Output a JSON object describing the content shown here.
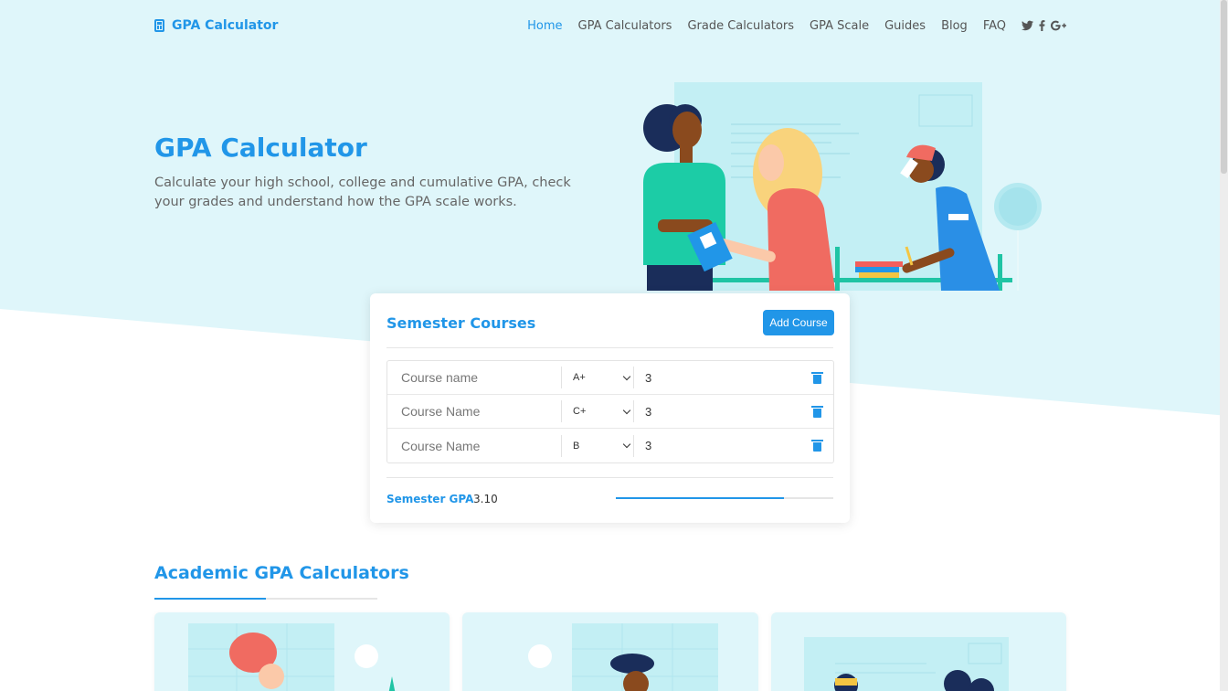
{
  "brand": {
    "name": "GPA Calculator",
    "icon": "calculator-icon"
  },
  "nav": {
    "items": [
      {
        "label": "Home",
        "active": true
      },
      {
        "label": "GPA Calculators",
        "active": false
      },
      {
        "label": "Grade Calculators",
        "active": false
      },
      {
        "label": "GPA Scale",
        "active": false
      },
      {
        "label": "Guides",
        "active": false
      },
      {
        "label": "Blog",
        "active": false
      },
      {
        "label": "FAQ",
        "active": false
      }
    ],
    "social": [
      "twitter-icon",
      "facebook-icon",
      "google-plus-icon"
    ]
  },
  "hero": {
    "title": "GPA Calculator",
    "description": "Calculate your high school, college and cumulative GPA, check your grades and understand how the GPA scale works."
  },
  "calculator": {
    "title": "Semester Courses",
    "add_label": "Add Course",
    "courses": [
      {
        "name_placeholder": "Course name",
        "grade": "A+",
        "credits": "3"
      },
      {
        "name_placeholder": "Course Name",
        "grade": "C+",
        "credits": "3"
      },
      {
        "name_placeholder": "Course Name",
        "grade": "B",
        "credits": "3"
      }
    ],
    "gpa_label": "Semester GPA",
    "gpa_value": "3.10",
    "gpa_progress": 0.775
  },
  "section": {
    "title": "Academic GPA Calculators",
    "progress": 0.5
  },
  "colors": {
    "accent": "#2196e8",
    "hero_bg": "#dff6fa",
    "tile_bg": "#dff6fa"
  }
}
